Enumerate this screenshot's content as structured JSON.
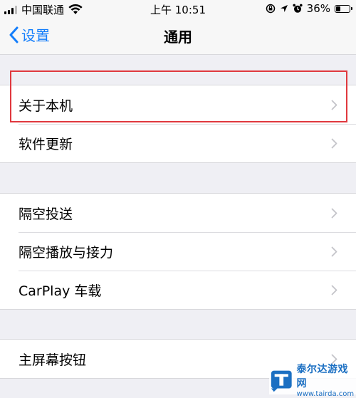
{
  "status_bar": {
    "carrier": "中国联通",
    "time": "上午 10:51",
    "battery": "36%",
    "battery_level": 0.36
  },
  "nav": {
    "back_label": "设置",
    "title": "通用"
  },
  "groups": [
    {
      "items": [
        {
          "label": "关于本机"
        },
        {
          "label": "软件更新"
        }
      ]
    },
    {
      "items": [
        {
          "label": "隔空投送"
        },
        {
          "label": "隔空播放与接力"
        },
        {
          "label": "CarPlay 车载"
        }
      ]
    },
    {
      "items": [
        {
          "label": "主屏幕按钮"
        }
      ]
    }
  ],
  "watermark": {
    "brand": "泰尔达游戏网",
    "url": "www.tairda.com"
  },
  "colors": {
    "accent": "#147efb",
    "highlight": "#e0383e",
    "background": "#efeff4"
  }
}
